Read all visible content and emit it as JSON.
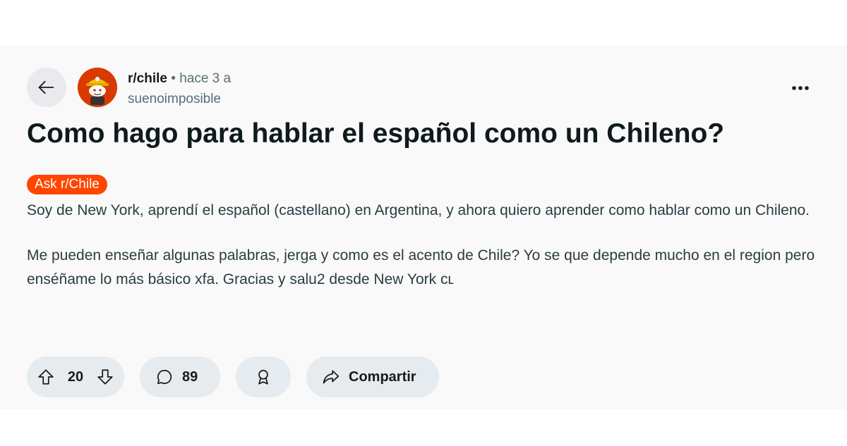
{
  "post": {
    "subreddit": "r/chile",
    "separator": "•",
    "time": "hace 3 a",
    "author": "suenoimposible",
    "title": "Como hago para hablar el español como un Chileno?",
    "flair": "Ask r/Chile",
    "paragraphs": [
      "Soy de New York, aprendí el español (castellano) en Argentina, y ahora quiero aprender como hablar como un Chileno.",
      "Me pueden enseñar algunas palabras, jerga y como es el acento de Chile? Yo se que depende mucho en el region pero enséñame lo más básico xfa. Gracias y salu2 desde New York cʟ"
    ]
  },
  "actions": {
    "score": "20",
    "comments": "89",
    "share_label": "Compartir"
  },
  "icons": {
    "back": "arrow-left-icon",
    "more": "more-horizontal-icon",
    "upvote": "upvote-arrow-icon",
    "downvote": "downvote-arrow-icon",
    "comment": "comment-bubble-icon",
    "award": "award-icon",
    "share": "share-arrow-icon"
  },
  "colors": {
    "flair_bg": "#ff4500",
    "avatar_bg": "#d93a00",
    "button_bg": "#e5ebee",
    "card_bg": "#f9f9f9"
  }
}
